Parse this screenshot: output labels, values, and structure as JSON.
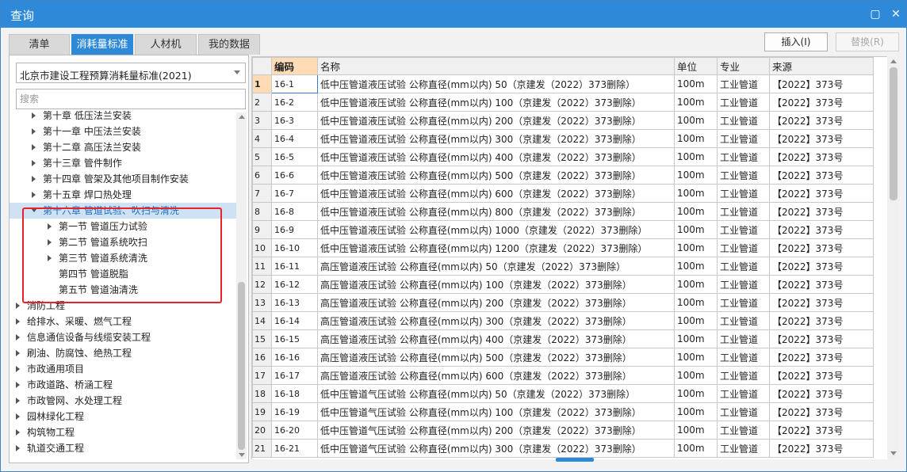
{
  "window": {
    "title": "查询",
    "maximize_glyph": "▢",
    "close_glyph": "✕",
    "accent": "#2e8ad8"
  },
  "tabs": [
    "清单",
    "消耗量标准",
    "人材机",
    "我的数据"
  ],
  "active_tab": 1,
  "toolbar": {
    "insert_label": "插入(I)",
    "replace_label": "替换(R)"
  },
  "standard_select": {
    "value": "北京市建设工程预算消耗量标准(2021)"
  },
  "search": {
    "placeholder": "搜索"
  },
  "tree": [
    {
      "label": "第十章 低压法兰安装",
      "level": 2,
      "arrow": "right"
    },
    {
      "label": "第十一章 中压法兰安装",
      "level": 2,
      "arrow": "right"
    },
    {
      "label": "第十二章 高压法兰安装",
      "level": 2,
      "arrow": "right"
    },
    {
      "label": "第十三章 管件制作",
      "level": 2,
      "arrow": "right"
    },
    {
      "label": "第十四章 管架及其他项目制作安装",
      "level": 2,
      "arrow": "right"
    },
    {
      "label": "第十五章 焊口热处理",
      "level": 2,
      "arrow": "right"
    },
    {
      "label": "第十六章 管道试验、吹扫与清洗",
      "level": 2,
      "arrow": "down",
      "selected": true
    },
    {
      "label": "第一节 管道压力试验",
      "level": 3,
      "arrow": "right"
    },
    {
      "label": "第二节 管道系统吹扫",
      "level": 3,
      "arrow": "right"
    },
    {
      "label": "第三节 管道系统清洗",
      "level": 3,
      "arrow": "right"
    },
    {
      "label": "第四节 管道脱脂",
      "level": 3,
      "arrow": "none"
    },
    {
      "label": "第五节 管道油清洗",
      "level": 3,
      "arrow": "none"
    },
    {
      "label": "消防工程",
      "level": 1,
      "arrow": "right"
    },
    {
      "label": "给排水、采暖、燃气工程",
      "level": 1,
      "arrow": "right"
    },
    {
      "label": "信息通信设备与线缆安装工程",
      "level": 1,
      "arrow": "right"
    },
    {
      "label": "刷油、防腐蚀、绝热工程",
      "level": 1,
      "arrow": "right"
    },
    {
      "label": "市政通用项目",
      "level": 1,
      "arrow": "right"
    },
    {
      "label": "市政道路、桥涵工程",
      "level": 1,
      "arrow": "right"
    },
    {
      "label": "市政管网、水处理工程",
      "level": 1,
      "arrow": "right"
    },
    {
      "label": "园林绿化工程",
      "level": 1,
      "arrow": "right"
    },
    {
      "label": "构筑物工程",
      "level": 1,
      "arrow": "right"
    },
    {
      "label": "轨道交通工程",
      "level": 1,
      "arrow": "right"
    }
  ],
  "grid": {
    "headers": [
      "",
      "编码",
      "名称",
      "单位",
      "专业",
      "来源"
    ],
    "current_row": 0,
    "rows": [
      [
        "1",
        "16-1",
        "低中压管道液压试验 公称直径(mm以内) 50（京建发（2022）373删除）",
        "100m",
        "工业管道",
        "【2022】373号"
      ],
      [
        "2",
        "16-2",
        "低中压管道液压试验 公称直径(mm以内) 100（京建发（2022）373删除）",
        "100m",
        "工业管道",
        "【2022】373号"
      ],
      [
        "3",
        "16-3",
        "低中压管道液压试验 公称直径(mm以内) 200（京建发（2022）373删除）",
        "100m",
        "工业管道",
        "【2022】373号"
      ],
      [
        "4",
        "16-4",
        "低中压管道液压试验 公称直径(mm以内) 300（京建发（2022）373删除）",
        "100m",
        "工业管道",
        "【2022】373号"
      ],
      [
        "5",
        "16-5",
        "低中压管道液压试验 公称直径(mm以内) 400（京建发（2022）373删除）",
        "100m",
        "工业管道",
        "【2022】373号"
      ],
      [
        "6",
        "16-6",
        "低中压管道液压试验 公称直径(mm以内) 500（京建发（2022）373删除）",
        "100m",
        "工业管道",
        "【2022】373号"
      ],
      [
        "7",
        "16-7",
        "低中压管道液压试验 公称直径(mm以内) 600（京建发（2022）373删除）",
        "100m",
        "工业管道",
        "【2022】373号"
      ],
      [
        "8",
        "16-8",
        "低中压管道液压试验 公称直径(mm以内) 800（京建发（2022）373删除）",
        "100m",
        "工业管道",
        "【2022】373号"
      ],
      [
        "9",
        "16-9",
        "低中压管道液压试验 公称直径(mm以内) 1000（京建发（2022）373删除）",
        "100m",
        "工业管道",
        "【2022】373号"
      ],
      [
        "10",
        "16-10",
        "低中压管道液压试验 公称直径(mm以内) 1200（京建发（2022）373删除）",
        "100m",
        "工业管道",
        "【2022】373号"
      ],
      [
        "11",
        "16-11",
        "高压管道液压试验 公称直径(mm以内) 50（京建发（2022）373删除）",
        "100m",
        "工业管道",
        "【2022】373号"
      ],
      [
        "12",
        "16-12",
        "高压管道液压试验 公称直径(mm以内) 100（京建发（2022）373删除）",
        "100m",
        "工业管道",
        "【2022】373号"
      ],
      [
        "13",
        "16-13",
        "高压管道液压试验 公称直径(mm以内) 200（京建发（2022）373删除）",
        "100m",
        "工业管道",
        "【2022】373号"
      ],
      [
        "14",
        "16-14",
        "高压管道液压试验 公称直径(mm以内) 300（京建发（2022）373删除）",
        "100m",
        "工业管道",
        "【2022】373号"
      ],
      [
        "15",
        "16-15",
        "高压管道液压试验 公称直径(mm以内) 400（京建发（2022）373删除）",
        "100m",
        "工业管道",
        "【2022】373号"
      ],
      [
        "16",
        "16-16",
        "高压管道液压试验 公称直径(mm以内) 500（京建发（2022）373删除）",
        "100m",
        "工业管道",
        "【2022】373号"
      ],
      [
        "17",
        "16-17",
        "高压管道液压试验 公称直径(mm以内) 600（京建发（2022）373删除）",
        "100m",
        "工业管道",
        "【2022】373号"
      ],
      [
        "18",
        "16-18",
        "低中压管道气压试验 公称直径(mm以内) 50（京建发（2022）373删除）",
        "100m",
        "工业管道",
        "【2022】373号"
      ],
      [
        "19",
        "16-19",
        "低中压管道气压试验 公称直径(mm以内) 100（京建发（2022）373删除）",
        "100m",
        "工业管道",
        "【2022】373号"
      ],
      [
        "20",
        "16-20",
        "低中压管道气压试验 公称直径(mm以内) 200（京建发（2022）373删除）",
        "100m",
        "工业管道",
        "【2022】373号"
      ],
      [
        "21",
        "16-21",
        "低中压管道气压试验 公称直径(mm以内) 300（京建发（2022）373删除）",
        "100m",
        "工业管道",
        "【2022】373号"
      ]
    ]
  }
}
